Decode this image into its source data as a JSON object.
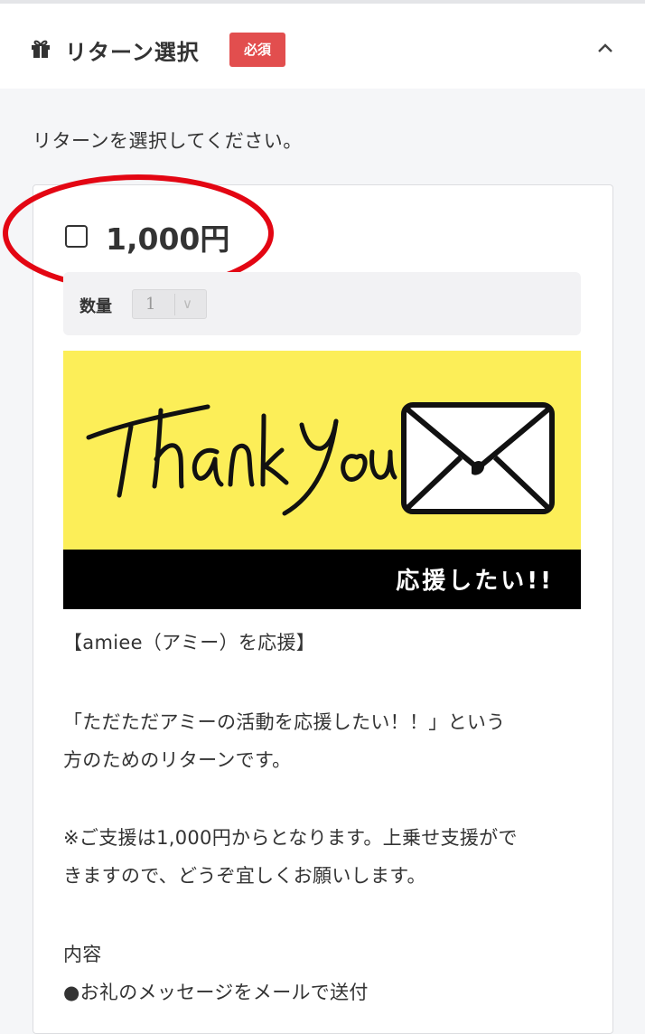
{
  "header": {
    "gift_icon": "gift-icon",
    "title": "リターン選択",
    "required_badge": "必須",
    "collapse_icon": "chevron-up-icon",
    "badge_color": "#e24e4e"
  },
  "instruction": "リターンを選択してください。",
  "reward": {
    "price": "1,000円",
    "checked": false,
    "quantity_label": "数量",
    "quantity_value": "1",
    "banner_script_text": "Thank You",
    "banner_caption": "応援したい!!",
    "banner_color": "#fcee58",
    "highlight_color": "#e30613",
    "description": {
      "heading": "【amiee（アミー）を応援】",
      "para1_line1": "「ただただアミーの活動を応援したい！！」という",
      "para1_line2": "方のためのリターンです。",
      "para2_line1": "※ご支援は1,000円からとなります。上乗せ支援がで",
      "para2_line2": "きますので、どうぞ宜しくお願いします。",
      "contents_label": "内容",
      "contents_item1": "●お礼のメッセージをメールで送付"
    }
  }
}
